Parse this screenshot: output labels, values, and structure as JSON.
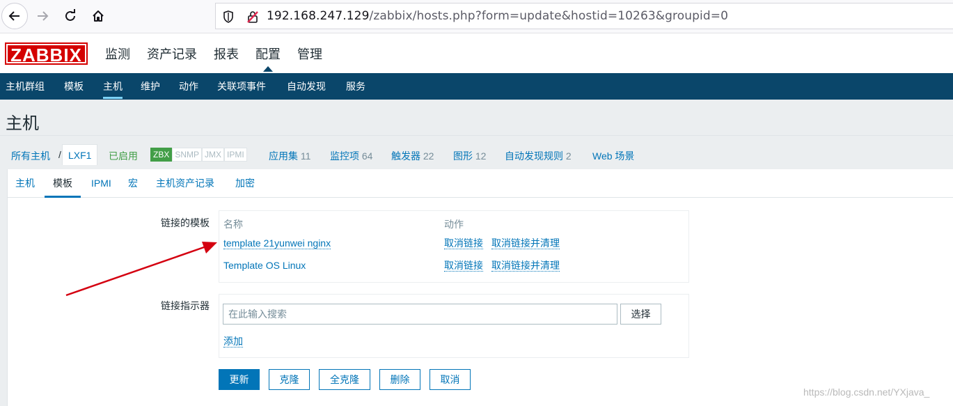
{
  "browser": {
    "url_host": "192.168.247.129",
    "url_path": "/zabbix/hosts.php?form=update&hostid=10263&groupid=0"
  },
  "header": {
    "logo": "ZABBIX",
    "menu": [
      "监测",
      "资产记录",
      "报表",
      "配置",
      "管理"
    ],
    "active_menu": "配置"
  },
  "submenu": {
    "items": [
      "主机群组",
      "模板",
      "主机",
      "维护",
      "动作",
      "关联项事件",
      "自动发现",
      "服务"
    ],
    "active": "主机"
  },
  "page": {
    "title": "主机"
  },
  "breadcrumb": {
    "all_hosts": "所有主机",
    "separator": "/",
    "current_host": "LXF1",
    "status": "已启用",
    "protocols": [
      "ZBX",
      "SNMP",
      "JMX",
      "IPMI"
    ],
    "links": [
      {
        "label": "应用集",
        "count": "11"
      },
      {
        "label": "监控项",
        "count": "64"
      },
      {
        "label": "触发器",
        "count": "22"
      },
      {
        "label": "图形",
        "count": "12"
      },
      {
        "label": "自动发现规则",
        "count": "2"
      },
      {
        "label": "Web 场景",
        "count": ""
      }
    ]
  },
  "tabs": {
    "items": [
      "主机",
      "模板",
      "IPMI",
      "宏",
      "主机资产记录",
      "加密"
    ],
    "active": "模板"
  },
  "linked_templates": {
    "label": "链接的模板",
    "col_name": "名称",
    "col_action": "动作",
    "rows": [
      {
        "name": "template 21yunwei nginx",
        "unlink": "取消链接",
        "unlink_clear": "取消链接并清理"
      },
      {
        "name": "Template OS Linux",
        "unlink": "取消链接",
        "unlink_clear": "取消链接并清理"
      }
    ]
  },
  "link_new": {
    "label": "链接指示器",
    "placeholder": "在此输入搜索",
    "select_button": "选择",
    "add_link": "添加"
  },
  "buttons": {
    "update": "更新",
    "clone": "克隆",
    "full_clone": "全克隆",
    "delete": "删除",
    "cancel": "取消"
  },
  "watermark": "https://blog.csdn.net/YXjava_"
}
